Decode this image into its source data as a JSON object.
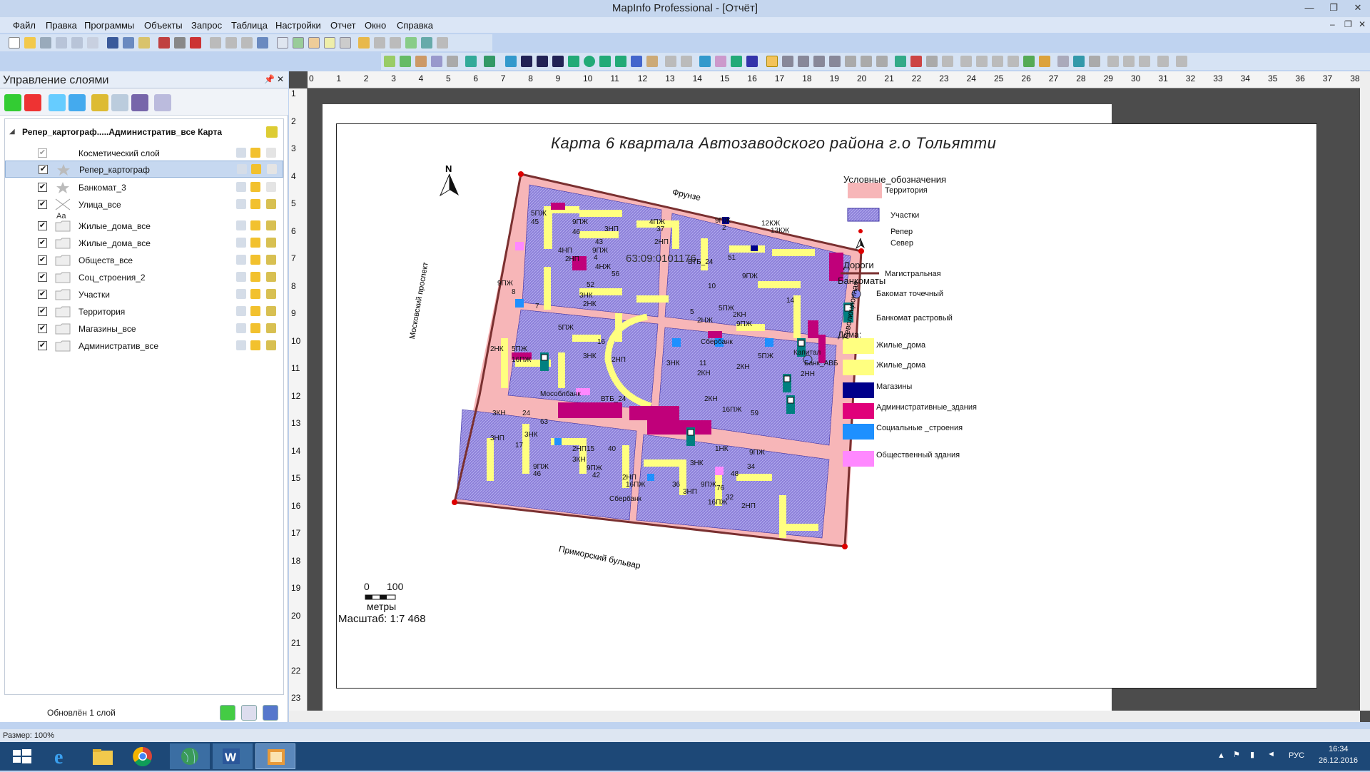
{
  "window": {
    "title": "MapInfo Professional - [Отчёт]",
    "min": "—",
    "restore": "❐",
    "close": "✕"
  },
  "menu": {
    "items": [
      "Файл",
      "Правка",
      "Программы",
      "Объекты",
      "Запрос",
      "Таблица",
      "Настройки",
      "Отчет",
      "Окно",
      "Справка"
    ],
    "mdi_min": "–",
    "mdi_restore": "❐",
    "mdi_close": "✕"
  },
  "layer_panel": {
    "title": "Управление слоями",
    "pin": "📌",
    "close": "✕",
    "root_label": "Репер_картограф.....Административ_все Карта",
    "layers": [
      {
        "name": "Косметический слой",
        "checked": true,
        "dim": true,
        "icon": "none"
      },
      {
        "name": "Репер_картограф",
        "checked": true,
        "selected": true,
        "icon": "star"
      },
      {
        "name": "Банкомат_3",
        "checked": true,
        "icon": "star"
      },
      {
        "name": "Улица_все",
        "checked": true,
        "icon": "line"
      },
      {
        "name": "Жилые_дома_все",
        "checked": true,
        "icon": "region"
      },
      {
        "name": "Жилые_дома_все",
        "checked": true,
        "icon": "region"
      },
      {
        "name": "Обществ_все",
        "checked": true,
        "icon": "region"
      },
      {
        "name": "Соц_строения_2",
        "checked": true,
        "icon": "region"
      },
      {
        "name": "Участки",
        "checked": true,
        "icon": "region"
      },
      {
        "name": "Территория",
        "checked": true,
        "icon": "region"
      },
      {
        "name": "Магазины_все",
        "checked": true,
        "icon": "region"
      },
      {
        "name": "Административ_все",
        "checked": true,
        "icon": "region"
      }
    ],
    "label_aa": "Aa",
    "footer_status": "Обновлён 1 слой"
  },
  "report": {
    "map_title": "Карта 6 квартала Автозаводского района г.о Тольятти",
    "north": "N",
    "streets": {
      "frunze": "Фрунзе",
      "moskovsky": "Московский проспект",
      "primorsky": "Приморский бульвар",
      "revolutsionnaya": "Революционная"
    },
    "cadastre": "63:09:0101176",
    "map_labels": [
      "5ПЖ",
      "45",
      "9ПЖ",
      "46",
      "3НП",
      "43",
      "4ПЖ",
      "37",
      "2НП",
      "9ПЖ",
      "2",
      "12КЖ",
      "13КЖ",
      "4НП",
      "2НП",
      "9ПЖ",
      "4",
      "4НЖ",
      "56",
      "ВТБ_24",
      "51",
      "9ПЖ",
      "10",
      "9ПЖ",
      "8",
      "3НК",
      "2НК",
      "52",
      "5ПЖ",
      "7",
      "5ПЖ",
      "5",
      "2НЖ",
      "2КН",
      "9ПЖ",
      "14",
      "2НК",
      "5ПЖ",
      "16",
      "3НК",
      "2НП",
      "5ПЖ",
      "2КН",
      "16ПЖ",
      "11",
      "2КН",
      "3НК",
      "Сбербанк",
      "Капитал",
      "Банк_АВБ",
      "2НН",
      "Мособлбанк",
      "ВТБ_24",
      "2КН",
      "16ПЖ",
      "59",
      "3КН",
      "24",
      "63",
      "3НК",
      "3НП",
      "17",
      "2НП15",
      "3КН",
      "40",
      "1НК",
      "34",
      "3НК",
      "9ПЖ",
      "48",
      "9ПЖ",
      "46",
      "9ПЖ",
      "42",
      "2НП",
      "16ПЖ",
      "36",
      "3НП",
      "9ПЖ",
      "76",
      "16ПЖ",
      "32",
      "2НП",
      "Сбербанк"
    ],
    "legend": {
      "title": "Условные_обозначения",
      "territory": "Территория",
      "parcels": "Участки",
      "benchmark": "Репер",
      "north": "Север",
      "roads_title": "Дороги",
      "main_road": "Магистральная",
      "atm_title": "Банкоматы",
      "atm_point": "Бакомат точечный",
      "atm_raster": "Банкомат растровый",
      "houses_title": "Дома:",
      "residential1": "Жилые_дома",
      "residential2": "Жилые_дома",
      "shops": "Магазины",
      "admin": "Административные_здания",
      "social": "Социальные _строения",
      "public": "Общественный здания"
    },
    "scale": {
      "zero": "0",
      "hundred": "100",
      "unit": "метры",
      "text": "Масштаб: 1:7 468"
    },
    "colors": {
      "territory": "#f7b6b8",
      "parcels": "#8b7fd8",
      "residential": "#ffff80",
      "shops": "#00008b",
      "admin": "#e0007a",
      "social": "#1e90ff",
      "public": "#ff88ff",
      "road": "#7a3030",
      "atm": "#008080"
    }
  },
  "ruler": {
    "h": [
      "0",
      "1",
      "2",
      "3",
      "4",
      "5",
      "6",
      "7",
      "8",
      "9",
      "10",
      "11",
      "12",
      "13",
      "14",
      "15",
      "16",
      "17",
      "18",
      "19",
      "20",
      "21",
      "22",
      "23",
      "24",
      "25",
      "26",
      "27",
      "28",
      "29",
      "30",
      "31",
      "32",
      "33",
      "34",
      "35",
      "36",
      "37",
      "38"
    ],
    "v": [
      "1",
      "2",
      "3",
      "4",
      "5",
      "6",
      "7",
      "8",
      "9",
      "10",
      "11",
      "12",
      "13",
      "14",
      "15",
      "16",
      "17",
      "18",
      "19",
      "20",
      "21",
      "22",
      "23"
    ]
  },
  "statusbar": {
    "text": "Размер: 100%"
  },
  "taskbar": {
    "lang": "РУС",
    "time": "16:34",
    "date": "26.12.2016",
    "apps": [
      "start-icon",
      "ie-icon",
      "explorer-icon",
      "chrome-icon",
      "globe-icon",
      "word-icon",
      "mapinfo-icon"
    ]
  }
}
